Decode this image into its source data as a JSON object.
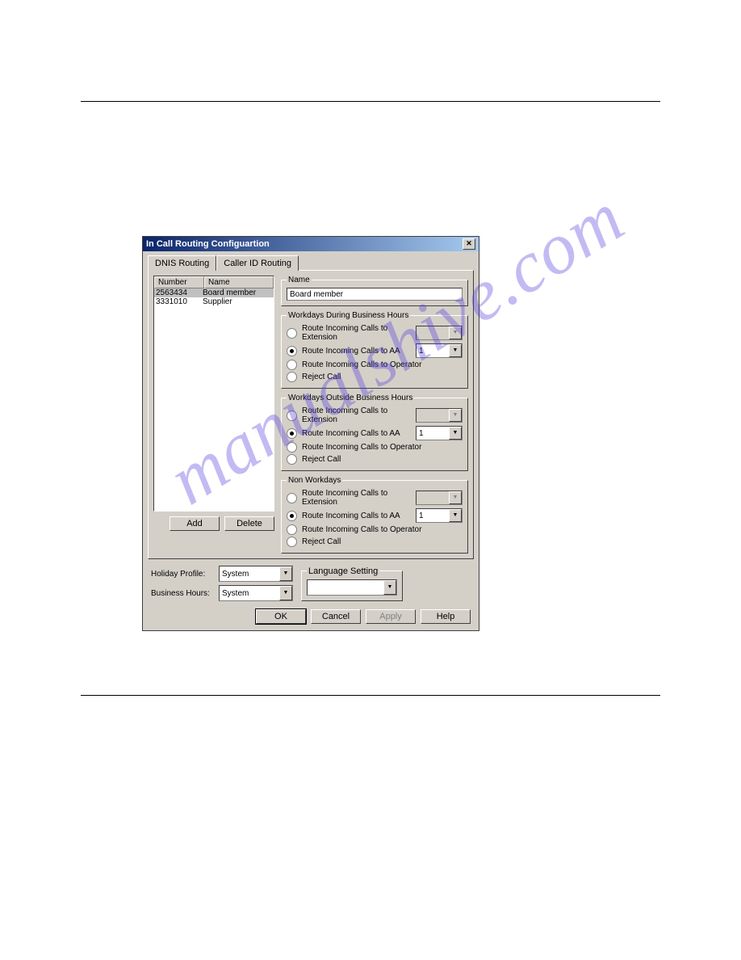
{
  "dialog": {
    "title": "In Call Routing Configuartion",
    "tabs": {
      "dnis": "DNIS Routing",
      "callerid": "Caller ID Routing"
    },
    "list": {
      "col_number": "Number",
      "col_name": "Name",
      "rows": [
        {
          "num": "2563434",
          "name": "Board member"
        },
        {
          "num": "3331010",
          "name": "Supplier"
        }
      ],
      "add": "Add",
      "delete": "Delete"
    },
    "name_group": {
      "legend": "Name",
      "value": "Board member"
    },
    "groups": [
      {
        "legend": "Workdays During Business Hours",
        "opts": [
          {
            "label": "Route Incoming Calls to Extension",
            "sel": false,
            "combo": "",
            "combo_enabled": false
          },
          {
            "label": "Route Incoming Calls to AA",
            "sel": true,
            "combo": "1",
            "combo_enabled": true
          },
          {
            "label": "Route Incoming Calls to Operator",
            "sel": false
          },
          {
            "label": "Reject Call",
            "sel": false
          }
        ]
      },
      {
        "legend": "Workdays Outside Business Hours",
        "opts": [
          {
            "label": "Route Incoming Calls to Extension",
            "sel": false,
            "combo": "",
            "combo_enabled": false
          },
          {
            "label": "Route Incoming Calls to AA",
            "sel": true,
            "combo": "1",
            "combo_enabled": true
          },
          {
            "label": "Route Incoming Calls to Operator",
            "sel": false
          },
          {
            "label": "Reject Call",
            "sel": false
          }
        ]
      },
      {
        "legend": "Non Workdays",
        "opts": [
          {
            "label": "Route Incoming Calls to Extension",
            "sel": false,
            "combo": "",
            "combo_enabled": false
          },
          {
            "label": "Route Incoming Calls to AA",
            "sel": true,
            "combo": "1",
            "combo_enabled": true
          },
          {
            "label": "Route Incoming Calls to Operator",
            "sel": false
          },
          {
            "label": "Reject Call",
            "sel": false
          }
        ]
      }
    ],
    "holiday_label": "Holiday Profile:",
    "holiday_value": "System",
    "bh_label": "Business Hours:",
    "bh_value": "System",
    "lang_legend": "Language Setting",
    "lang_value": "",
    "buttons": {
      "ok": "OK",
      "cancel": "Cancel",
      "apply": "Apply",
      "help": "Help"
    }
  },
  "watermark": "manualshive.com"
}
